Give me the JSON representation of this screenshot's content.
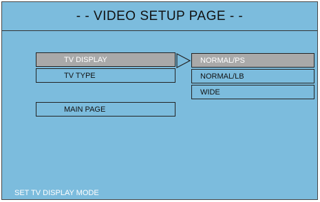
{
  "header": {
    "title": "- - VIDEO SETUP PAGE - -"
  },
  "menu": {
    "items": [
      {
        "label": "TV DISPLAY",
        "active": true
      },
      {
        "label": "TV TYPE",
        "active": false
      },
      {
        "label": "MAIN PAGE",
        "active": false
      }
    ]
  },
  "submenu": {
    "options": [
      {
        "label": "NORMAL/PS",
        "selected": true
      },
      {
        "label": "NORMAL/LB",
        "selected": false
      },
      {
        "label": "WIDE",
        "selected": false
      }
    ]
  },
  "status": {
    "text": "SET TV DISPLAY MODE"
  },
  "colors": {
    "background": "#7cbcdd",
    "highlight": "#a9a9a9",
    "border": "#222222"
  }
}
